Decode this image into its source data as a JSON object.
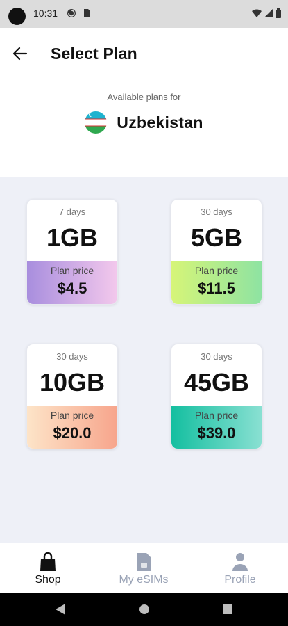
{
  "status_bar": {
    "time": "10:31"
  },
  "header": {
    "title": "Select Plan"
  },
  "country": {
    "available_label": "Available plans for",
    "name": "Uzbekistan"
  },
  "plans": [
    {
      "days": "7 days",
      "size": "1GB",
      "price_label": "Plan price",
      "price": "$4.5"
    },
    {
      "days": "30 days",
      "size": "5GB",
      "price_label": "Plan price",
      "price": "$11.5"
    },
    {
      "days": "30 days",
      "size": "10GB",
      "price_label": "Plan price",
      "price": "$20.0"
    },
    {
      "days": "30 days",
      "size": "45GB",
      "price_label": "Plan price",
      "price": "$39.0"
    }
  ],
  "colors": {
    "plan_1": [
      "#a88ede",
      "#f3c8ec"
    ],
    "plan_2": [
      "#d6f578",
      "#8ee3a2"
    ],
    "plan_3": [
      "#fde4c8",
      "#f7a58c"
    ],
    "plan_4": [
      "#14bfa0",
      "#89e0d2"
    ],
    "plans_background": "#eef0f7",
    "nav_active": "#111111",
    "nav_inactive": "#9aa3b6"
  },
  "bottom_nav": [
    {
      "label": "Shop",
      "icon": "shopping-bag-icon",
      "active": true
    },
    {
      "label": "My eSIMs",
      "icon": "sim-card-icon",
      "active": false
    },
    {
      "label": "Profile",
      "icon": "person-icon",
      "active": false
    }
  ]
}
